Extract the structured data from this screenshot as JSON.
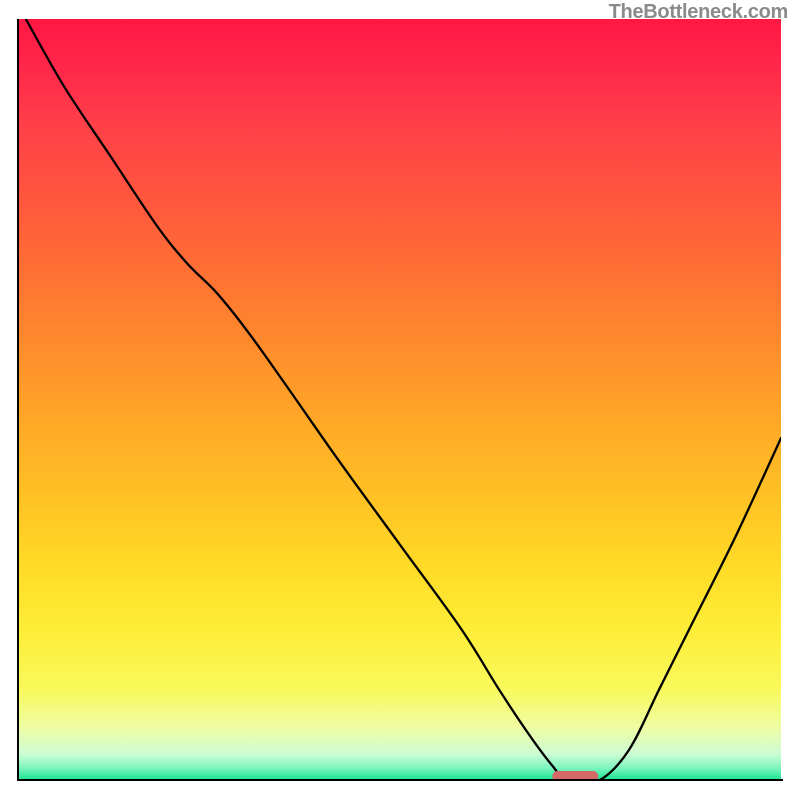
{
  "watermark": "TheBottleneck.com",
  "chart_data": {
    "type": "line",
    "title": "",
    "xlabel": "",
    "ylabel": "",
    "xlim": [
      0,
      100
    ],
    "ylim": [
      0,
      100
    ],
    "background_gradient": {
      "stops": [
        {
          "pos": 0,
          "color": "#ff1744"
        },
        {
          "pos": 0.5,
          "color": "#ffab26"
        },
        {
          "pos": 0.8,
          "color": "#feed37"
        },
        {
          "pos": 1.0,
          "color": "#0de38d"
        }
      ]
    },
    "series": [
      {
        "name": "bottleneck-curve",
        "color": "#000000",
        "x": [
          0.9,
          6,
          12,
          18,
          22,
          26,
          30,
          35,
          42,
          50,
          58,
          63,
          67,
          70,
          72,
          76,
          80,
          84,
          88,
          94,
          100
        ],
        "y": [
          100,
          91,
          82,
          73,
          68,
          64,
          59,
          52,
          42,
          31,
          20,
          12,
          6,
          2,
          0,
          0,
          4,
          12,
          20,
          32,
          45
        ]
      }
    ],
    "marker": {
      "name": "optimal-marker",
      "color": "#d46a68",
      "x_center": 73,
      "width": 6,
      "y": 0
    }
  }
}
